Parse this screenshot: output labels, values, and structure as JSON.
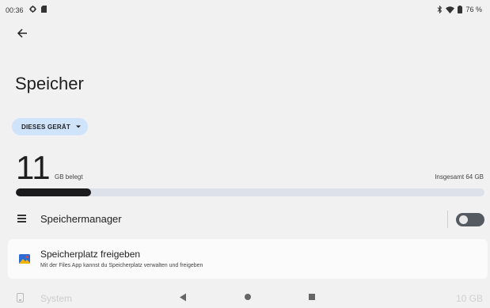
{
  "status": {
    "time": "00:36",
    "battery_text": "76 %",
    "icons_left": [
      "settings-icon",
      "sd-card-icon"
    ],
    "icons_right": [
      "bluetooth-icon",
      "wifi-icon",
      "battery-icon"
    ]
  },
  "header": {
    "back_icon": "arrow-back-icon",
    "title": "Speicher"
  },
  "device_selector": {
    "label": "DIESES GERÄT",
    "icon": "dropdown-arrow-icon",
    "accent": "#cfe3fb"
  },
  "usage": {
    "used_number": "11",
    "used_label": "GB belegt",
    "total_label": "Insgesamt 64 GB",
    "progress_fraction": 0.16
  },
  "manager": {
    "icon": "list-icon",
    "label": "Speichermanager",
    "toggle_on": false
  },
  "free_space": {
    "icon": "files-app-icon",
    "title": "Speicherplatz freigeben",
    "subtitle": "Mit der Files App kannst du Speicherplatz verwalten und freigeben"
  },
  "system_row": {
    "icon": "phone-icon",
    "label": "System",
    "value": "10 GB"
  },
  "nav": {
    "back": "nav-back-icon",
    "home": "nav-home-icon",
    "recents": "nav-recents-icon"
  }
}
